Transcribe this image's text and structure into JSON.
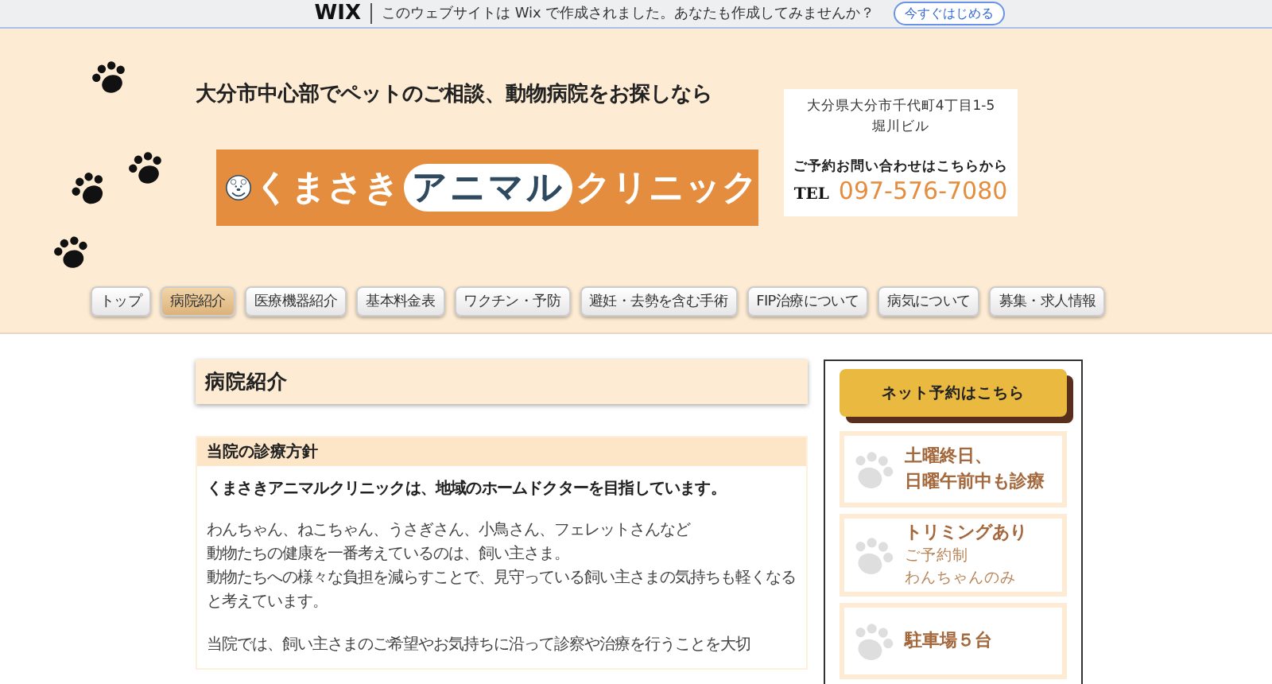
{
  "wix_banner": {
    "logo": "WIX",
    "message": "このウェブサイトは Wix で作成されました。あなたも作成してみませんか？",
    "button": "今すぐはじめる"
  },
  "header": {
    "tagline": "大分市中心部でペットのご相談、動物病院をお探しなら",
    "logo": [
      {
        "text": "くまさき",
        "kind": "plain"
      },
      {
        "text": "アニマル",
        "kind": "circled"
      },
      {
        "text": "クリニック",
        "kind": "plain"
      }
    ],
    "address": [
      "大分県大分市千代町4丁目1-5",
      "堀川ビル"
    ],
    "contact_label": "ご予約お問い合わせはこちらから",
    "tel_label": "TEL",
    "tel": "097-576-7080"
  },
  "nav": [
    {
      "label": "トップ",
      "selected": false
    },
    {
      "label": "病院紹介",
      "selected": true
    },
    {
      "label": "医療機器紹介",
      "selected": false
    },
    {
      "label": "基本料金表",
      "selected": false
    },
    {
      "label": "ワクチン・予防",
      "selected": false
    },
    {
      "label": "避妊・去勢を含む手術",
      "selected": false
    },
    {
      "label": "FIP治療について",
      "selected": false
    },
    {
      "label": "病気について",
      "selected": false
    },
    {
      "label": "募集・求人情報",
      "selected": false
    }
  ],
  "page_title": "病院紹介",
  "section": {
    "title": "当院の診療方針",
    "lead": "くまさきアニマルクリニックは、地域のホームドクターを目指しています。",
    "paragraphs": [
      [
        "わんちゃん、ねこちゃん、うさぎさん、小鳥さん、フェレットさんなど",
        "動物たちの健康を一番考えているのは、飼い主さま。",
        "動物たちへの様々な負担を減らすことで、見守っている飼い主さまの気持ちも軽くなると考えています。"
      ],
      [
        "当院では、飼い主さまのご希望やお気持ちに沿って診察や治療を行うことを大切"
      ]
    ]
  },
  "sidebar": {
    "reserve_button": "ネット予約はこちら",
    "cards": [
      {
        "title": [
          "土曜終日、",
          "日曜午前中も診療"
        ]
      },
      {
        "title": [
          "トリミングあり"
        ],
        "notes": [
          "ご予約制",
          "わんちゃんのみ"
        ]
      },
      {
        "title": [
          "駐車場５台"
        ]
      }
    ]
  }
}
